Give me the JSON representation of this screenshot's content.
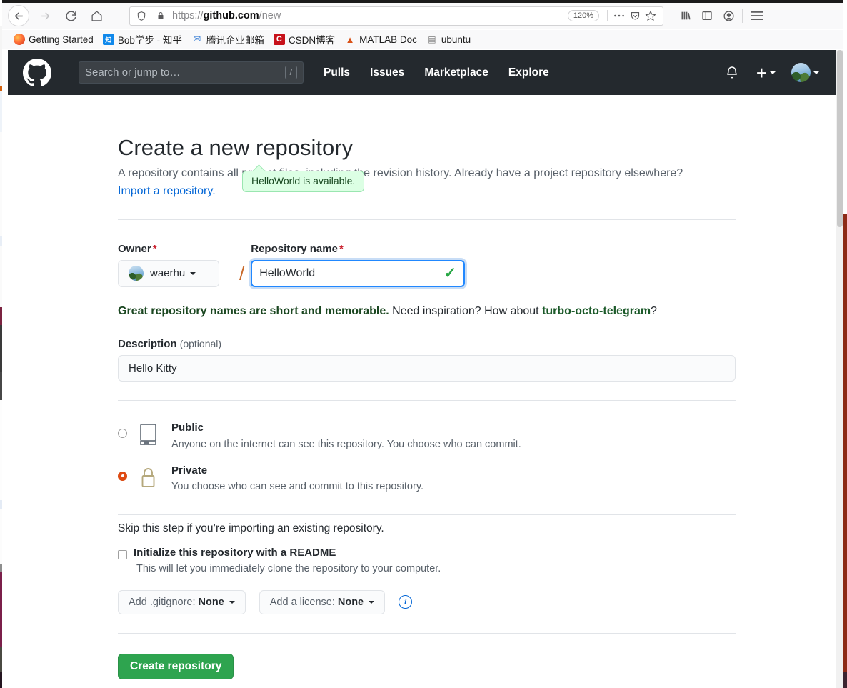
{
  "browser": {
    "url_scheme": "https://",
    "url_host": "github.com",
    "url_path": "/new",
    "zoom_level": "120%",
    "back_icon": "back-arrow-icon",
    "forward_icon": "forward-arrow-icon",
    "reload_icon": "reload-icon",
    "home_icon": "home-icon",
    "shield_icon": "shield-icon",
    "lock_icon": "padlock-icon",
    "page_actions_icon": "ellipsis-icon",
    "pocket_icon": "pocket-icon",
    "bookmark_star_icon": "star-icon",
    "library_icon": "library-icon",
    "sidebar_icon": "sidebar-icon",
    "account_icon": "account-icon",
    "menu_icon": "hamburger-menu-icon",
    "bookmarks": [
      {
        "label": "Getting Started",
        "icon": "firefox-icon"
      },
      {
        "label": "Bob学步 - 知乎",
        "icon": "zhihu-icon",
        "glyph": "知"
      },
      {
        "label": "腾讯企业邮箱",
        "icon": "tencent-mail-icon",
        "glyph": "✉"
      },
      {
        "label": "CSDN博客",
        "icon": "csdn-icon",
        "glyph": "C"
      },
      {
        "label": "MATLAB Doc",
        "icon": "matlab-icon",
        "glyph": "▲"
      },
      {
        "label": "ubuntu",
        "icon": "folder-icon",
        "glyph": "▤"
      }
    ]
  },
  "gh_header": {
    "logo_icon": "github-mark-icon",
    "search_placeholder": "Search or jump to…",
    "search_shortcut": "/",
    "nav": [
      {
        "label": "Pulls"
      },
      {
        "label": "Issues"
      },
      {
        "label": "Marketplace"
      },
      {
        "label": "Explore"
      }
    ],
    "notifications_icon": "bell-icon",
    "create_new_label": "+",
    "avatar_icon": "user-avatar"
  },
  "main": {
    "title": "Create a new repository",
    "subtitle": "A repository contains all project files, including the revision history. Already have a project repository elsewhere?",
    "import_link": "Import a repository.",
    "owner": {
      "label": "Owner",
      "required_mark": "*",
      "value": "waerhu",
      "avatar_icon": "user-avatar"
    },
    "separator": "/",
    "repo_name": {
      "label": "Repository name",
      "required_mark": "*",
      "value": "HelloWorld",
      "valid_icon": "checkmark-icon"
    },
    "availability_tooltip": "HelloWorld is available.",
    "hint_prefix": "Great repository names are short and memorable.",
    "hint_middle": "Need inspiration? How about",
    "hint_suggestion": "turbo-octo-telegram",
    "hint_suffix": "?",
    "description": {
      "label": "Description",
      "optional_label": "(optional)",
      "value": "Hello Kitty"
    },
    "visibility": [
      {
        "id": "public",
        "title": "Public",
        "description": "Anyone on the internet can see this repository. You choose who can commit.",
        "icon": "repo-book-icon",
        "selected": false
      },
      {
        "id": "private",
        "title": "Private",
        "description": "You choose who can see and commit to this repository.",
        "icon": "lock-icon",
        "selected": true
      }
    ],
    "skip_note": "Skip this step if you’re importing an existing repository.",
    "readme": {
      "title": "Initialize this repository with a README",
      "description": "This will let you immediately clone the repository to your computer.",
      "checked": false
    },
    "gitignore_button": {
      "prefix": "Add .gitignore:",
      "value": "None"
    },
    "license_button": {
      "prefix": "Add a license:",
      "value": "None"
    },
    "info_icon": "info-icon",
    "submit_label": "Create repository"
  },
  "colors": {
    "gh_header_bg": "#24292e",
    "accent_blue": "#0366d6",
    "success_green": "#28a745",
    "button_green": "#2ea44f",
    "required_red": "#cb2431",
    "radio_selected": "#e04a13",
    "tooltip_bg": "#dcffe4"
  }
}
